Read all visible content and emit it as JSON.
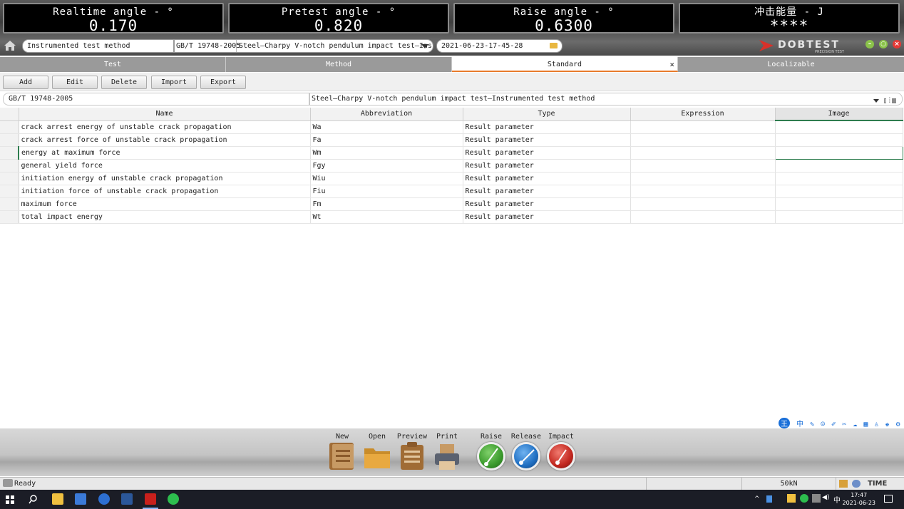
{
  "gauges": [
    {
      "label": "Realtime angle - °",
      "value": "0.170"
    },
    {
      "label": "Pretest angle - °",
      "value": "0.820"
    },
    {
      "label": "Raise angle - °",
      "value": "0.6300"
    },
    {
      "label": "冲击能量 - J",
      "value": "****"
    }
  ],
  "header": {
    "method": "Instrumented test method",
    "standard_code": "GB/T 19748-2005",
    "standard_title": "Steel—Charpy V-notch pendulum impact test—Instr",
    "timestamp": "2021-06-23-17-45-28",
    "logo_text": "DOBTEST",
    "logo_sub": "PRECISION TEST"
  },
  "tabs": [
    {
      "label": "Test",
      "active": false
    },
    {
      "label": "Method",
      "active": false
    },
    {
      "label": "Standard",
      "active": true,
      "close": "×"
    },
    {
      "label": "Localizable",
      "active": false
    }
  ],
  "toolbar": {
    "add": "Add",
    "edit": "Edit",
    "delete": "Delete",
    "import": "Import",
    "export": "Export"
  },
  "filter": {
    "code": "GB/T 19748-2005",
    "title": "Steel—Charpy V-notch pendulum impact test—Instrumented test method"
  },
  "table": {
    "columns": [
      "Name",
      "Abbreviation",
      "Type",
      "Expression",
      "Image"
    ],
    "rows": [
      {
        "name": "crack arrest energy of unstable crack propagation",
        "abbr": "Wa",
        "type": "Result parameter",
        "expr": "",
        "image": ""
      },
      {
        "name": "crack arrest force of unstable crack propagation",
        "abbr": "Fa",
        "type": "Result parameter",
        "expr": "",
        "image": ""
      },
      {
        "name": "energy at maximum force",
        "abbr": "Wm",
        "type": "Result parameter",
        "expr": "",
        "image": ""
      },
      {
        "name": "general yield force",
        "abbr": "Fgy",
        "type": "Result parameter",
        "expr": "",
        "image": ""
      },
      {
        "name": "initiation energy of unstable crack propagation",
        "abbr": "Wiu",
        "type": "Result parameter",
        "expr": "",
        "image": ""
      },
      {
        "name": "initiation force of unstable crack propagation",
        "abbr": "Fiu",
        "type": "Result parameter",
        "expr": "",
        "image": ""
      },
      {
        "name": "maximum force",
        "abbr": "Fm",
        "type": "Result parameter",
        "expr": "",
        "image": ""
      },
      {
        "name": "total impact energy",
        "abbr": "Wt",
        "type": "Result parameter",
        "expr": "",
        "image": ""
      }
    ]
  },
  "ime": {
    "logo": "王",
    "lang": "中"
  },
  "dock": {
    "new": "New",
    "open": "Open",
    "preview": "Preview",
    "print": "Print",
    "raise": "Raise",
    "release": "Release",
    "impact": "Impact"
  },
  "status": {
    "ready": "Ready",
    "load": "50kN",
    "brand": "TIME"
  },
  "taskbar": {
    "time": "17:47",
    "date": "2021-06-23",
    "ime": "中"
  },
  "colors": {
    "accent_tab": "#e87b2b",
    "selection": "#2e7d4f",
    "raise": "#3a9a2c",
    "release": "#1f6fc2",
    "impact": "#c2271f"
  }
}
